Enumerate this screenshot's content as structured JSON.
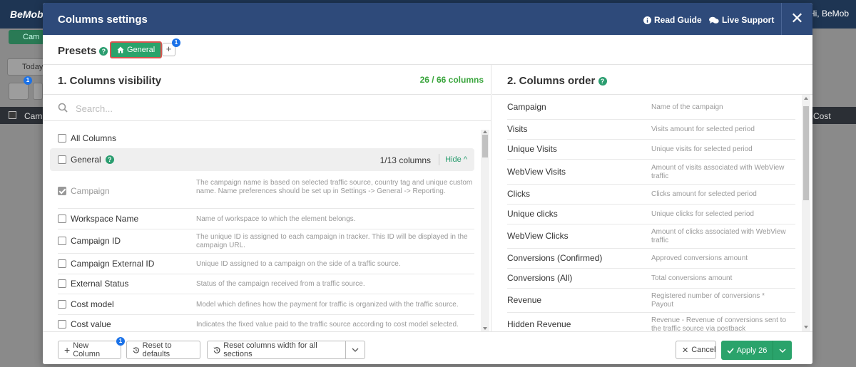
{
  "background": {
    "logo": "BeMob",
    "user_greeting": "Hi, BeMob",
    "campaign_tab": "Cam",
    "date_label": "Today",
    "table_col_campaign": "Camp",
    "table_col_cost": "Cost",
    "badge": "1"
  },
  "modal": {
    "title": "Columns settings",
    "read_guide": "Read Guide",
    "live_support": "Live Support",
    "close": "✕"
  },
  "presets": {
    "label": "Presets",
    "help": "?",
    "active_preset": "General",
    "add_label": "+",
    "add_badge": "1"
  },
  "visibility": {
    "title": "1. Columns visibility",
    "count": "26 / 66 columns",
    "search_placeholder": "Search...",
    "all_columns_label": "All Columns",
    "group": {
      "name": "General",
      "help": "?",
      "count": "1/13 columns",
      "toggle": "Hide ^"
    },
    "items": [
      {
        "name": "Campaign",
        "checked": true,
        "desc": "The campaign name is based on selected traffic source, country tag and unique custom name. Name preferences should be set up in Settings -> General -> Reporting."
      },
      {
        "name": "Workspace Name",
        "checked": false,
        "desc": "Name of workspace to which the element belongs."
      },
      {
        "name": "Campaign ID",
        "checked": false,
        "desc": "The unique ID is assigned to each campaign in tracker. This ID will be displayed in the campaign URL."
      },
      {
        "name": "Campaign External ID",
        "checked": false,
        "desc": "Unique ID assigned to a campaign on the side of a traffic source."
      },
      {
        "name": "External Status",
        "checked": false,
        "desc": "Status of the campaign received from a traffic source."
      },
      {
        "name": "Cost model",
        "checked": false,
        "desc": "Model which defines how the payment for traffic is organized with the traffic source."
      },
      {
        "name": "Cost value",
        "checked": false,
        "desc": "Indicates the fixed value paid to the traffic source according to cost model selected."
      }
    ]
  },
  "order": {
    "title": "2. Columns order",
    "help": "?",
    "items": [
      {
        "name": "Campaign",
        "desc": "Name of the campaign"
      },
      {
        "name": "Visits",
        "desc": "Visits amount for selected period"
      },
      {
        "name": "Unique Visits",
        "desc": "Unique visits for selected period"
      },
      {
        "name": "WebView Visits",
        "desc": "Amount of visits associated with WebView traffic"
      },
      {
        "name": "Clicks",
        "desc": "Clicks amount for selected period"
      },
      {
        "name": "Unique clicks",
        "desc": "Unique clicks for selected period"
      },
      {
        "name": "WebView Clicks",
        "desc": "Amount of clicks associated with WebView traffic"
      },
      {
        "name": "Conversions (Confirmed)",
        "desc": "Approved conversions amount"
      },
      {
        "name": "Conversions (All)",
        "desc": "Total conversions amount"
      },
      {
        "name": "Revenue",
        "desc": "Registered number of conversions * Payout"
      },
      {
        "name": "Hidden Revenue",
        "desc": "Revenue - Revenue of conversions sent to the traffic source via postback"
      }
    ]
  },
  "footer": {
    "new_column": "New Column",
    "new_column_badge": "1",
    "reset_defaults": "Reset to defaults",
    "reset_width": "Reset columns width for all sections",
    "cancel": "Cancel",
    "apply": "Apply 26"
  },
  "colors": {
    "header_bg": "#2e4a7a",
    "accent_green": "#2aa36b",
    "count_green": "#3aa53d",
    "badge_blue": "#1b72e8"
  }
}
